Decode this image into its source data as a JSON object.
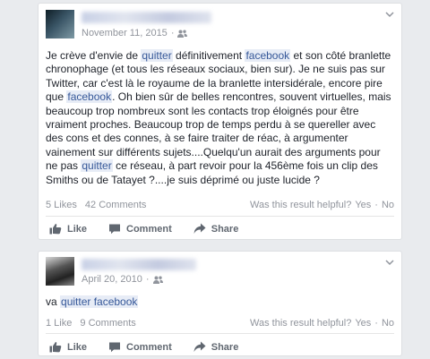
{
  "posts": [
    {
      "date": "November 11, 2015",
      "separator": "·",
      "audience_icon": "friends-icon",
      "text_segments": [
        {
          "t": "Je crève d'envie de ",
          "hl": false
        },
        {
          "t": "quitter",
          "hl": true
        },
        {
          "t": " définitivement ",
          "hl": false
        },
        {
          "t": "facebook",
          "hl": true
        },
        {
          "t": " et son côté branlette chronophage (et tous les réseaux sociaux, bien sur). Je ne suis pas sur Twitter, car c'est là le royaume de la branlette intersidérale, encore pire que ",
          "hl": false
        },
        {
          "t": "facebook",
          "hl": true
        },
        {
          "t": ". Oh bien sûr de belles rencontres, souvent virtuelles, mais beaucoup trop nombreux sont les contacts trop éloignés pour être vraiment proches. Beaucoup trop de temps perdu à se quereller avec des cons et des connes, à se faire traiter de réac, à argumenter vainement sur différents sujets....Quelqu'un aurait des arguments pour ne pas ",
          "hl": false
        },
        {
          "t": "quitter",
          "hl": true
        },
        {
          "t": " ce réseau, à part revoir pour la 456ème fois un clip des Smiths ou de Tatayet ?....je suis déprimé ou juste lucide ?",
          "hl": false
        }
      ],
      "likes": "5 Likes",
      "comments": "42 Comments",
      "helpful": {
        "question": "Was this result helpful?",
        "yes": "Yes",
        "dot": "·",
        "no": "No"
      },
      "actions": {
        "like": "Like",
        "comment": "Comment",
        "share": "Share"
      }
    },
    {
      "date": "April 20, 2010",
      "separator": "·",
      "audience_icon": "friends-icon",
      "text_segments": [
        {
          "t": "va ",
          "hl": false
        },
        {
          "t": "quitter facebook",
          "hl": true
        }
      ],
      "likes": "1 Like",
      "comments": "9 Comments",
      "helpful": {
        "question": "Was this result helpful?",
        "yes": "Yes",
        "dot": "·",
        "no": "No"
      },
      "actions": {
        "like": "Like",
        "comment": "Comment",
        "share": "Share"
      }
    }
  ],
  "colors": {
    "background": "#e9ebee",
    "highlight_bg": "#e7ecf6",
    "link": "#365899",
    "meta": "#90949c",
    "action": "#606770"
  }
}
